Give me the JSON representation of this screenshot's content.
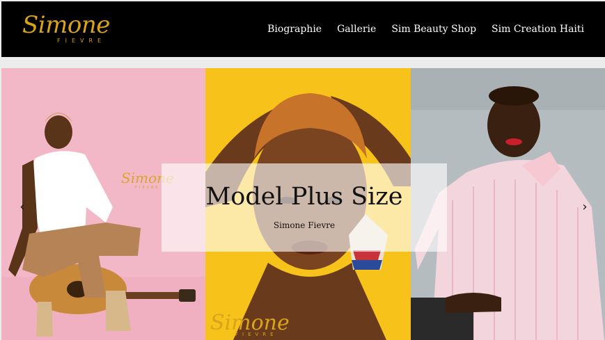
{
  "header": {
    "logo_script": "Simone",
    "logo_sub": "FIEVRE",
    "nav": [
      {
        "label": "Biographie"
      },
      {
        "label": "Gallerie"
      },
      {
        "label": "Sim Beauty Shop"
      },
      {
        "label": "Sim Creation Haiti"
      }
    ]
  },
  "slider": {
    "caption_title": "Model Plus Size",
    "caption_sub": "Simone Fievre",
    "prev_icon": "chevron-left-icon",
    "next_icon": "chevron-right-icon",
    "watermark_script": "Simone",
    "watermark_sub": "FIEVRE"
  },
  "colors": {
    "header_bg": "#000000",
    "brand_gold": "#d9a31a",
    "panel1_bg": "#f2b8c8",
    "panel2_bg": "#f7c21a",
    "panel3_bg": "#b5bcc0"
  }
}
